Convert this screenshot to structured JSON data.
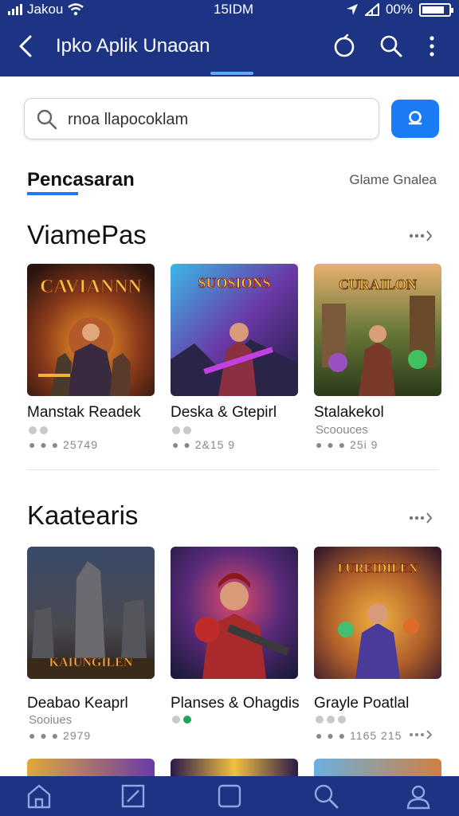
{
  "status_bar": {
    "carrier": "Jakou",
    "time": "15IDM",
    "battery": "00%",
    "battery_level": 0.85
  },
  "app_bar": {
    "title": "Ipko Aplik Unaoan",
    "icons": [
      "back-arrow-icon",
      "refresh-icon",
      "search-icon",
      "more-vert-icon"
    ]
  },
  "search": {
    "value": "rnoa llapocoklam",
    "button_icon": "search-icon"
  },
  "tabs": {
    "active": "Pencasaran",
    "right_label": "Glame Gnalea"
  },
  "sections": [
    {
      "title": "ViamePas",
      "more_icon": "more-arrow-icon",
      "cards": [
        {
          "image_title": "CAVIANNN",
          "title": "Manstak Readek",
          "meta": "25749"
        },
        {
          "image_title": "SUOSIONS",
          "title": "Deska & Gtepirl",
          "meta": "2&15 9"
        },
        {
          "image_title": "CURAILON",
          "title": "Stalakekol",
          "subtitle": "Scoouces",
          "meta": "25i 9"
        }
      ]
    },
    {
      "title": "Kaatearis",
      "more_icon": "more-arrow-icon",
      "cards": [
        {
          "image_title": "KAIUNGILEN",
          "title": "Deabao Keaprl",
          "subtitle": "Sooiues",
          "meta": "2979"
        },
        {
          "title": "Planses & Ohagdis"
        },
        {
          "image_title": "FUREIDILEN",
          "title": "Grayle Poatlal",
          "meta": "1165 215"
        }
      ]
    }
  ],
  "bottom_nav": [
    {
      "icon": "home-icon"
    },
    {
      "icon": "edit-square-icon"
    },
    {
      "icon": "square-icon"
    },
    {
      "icon": "search-icon"
    },
    {
      "icon": "profile-icon"
    }
  ]
}
